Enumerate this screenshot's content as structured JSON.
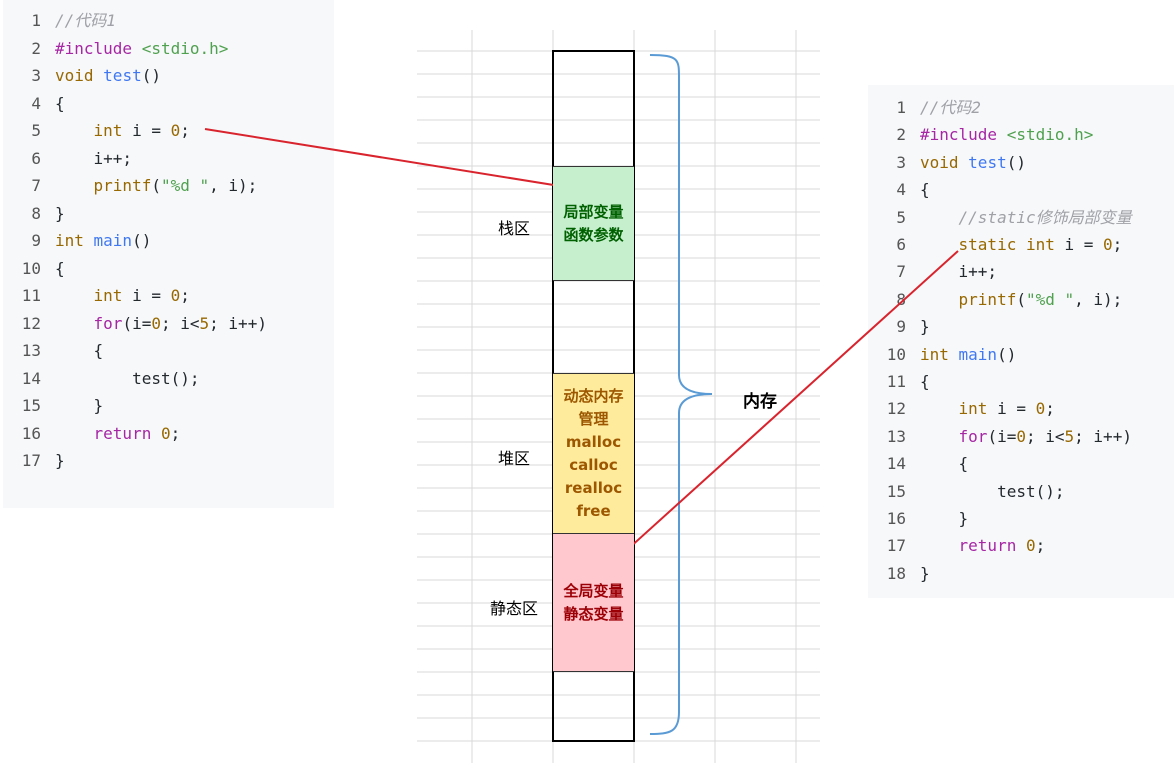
{
  "code1": {
    "lines": [
      {
        "n": "1",
        "tokens": [
          {
            "t": "//代码1",
            "c": "cm"
          }
        ]
      },
      {
        "n": "2",
        "tokens": [
          {
            "t": "#include ",
            "c": "inc"
          },
          {
            "t": "<stdio.h>",
            "c": "hdr"
          }
        ]
      },
      {
        "n": "3",
        "tokens": [
          {
            "t": "void ",
            "c": "ty"
          },
          {
            "t": "test",
            "c": "fn"
          },
          {
            "t": "()",
            "c": "pl"
          }
        ]
      },
      {
        "n": "4",
        "tokens": [
          {
            "t": "{",
            "c": "pl"
          }
        ]
      },
      {
        "n": "5",
        "tokens": [
          {
            "t": "    int ",
            "c": "ty"
          },
          {
            "t": "i = ",
            "c": "pl"
          },
          {
            "t": "0",
            "c": "num"
          },
          {
            "t": ";",
            "c": "pl"
          }
        ]
      },
      {
        "n": "6",
        "tokens": [
          {
            "t": "    i++;",
            "c": "pl"
          }
        ]
      },
      {
        "n": "7",
        "tokens": [
          {
            "t": "    printf",
            "c": "ty"
          },
          {
            "t": "(",
            "c": "pl"
          },
          {
            "t": "\"%d \"",
            "c": "str"
          },
          {
            "t": ", i);",
            "c": "pl"
          }
        ]
      },
      {
        "n": "8",
        "tokens": [
          {
            "t": "}",
            "c": "pl"
          }
        ]
      },
      {
        "n": "9",
        "tokens": [
          {
            "t": "int ",
            "c": "ty"
          },
          {
            "t": "main",
            "c": "fn"
          },
          {
            "t": "()",
            "c": "pl"
          }
        ]
      },
      {
        "n": "10",
        "tokens": [
          {
            "t": "{",
            "c": "pl"
          }
        ]
      },
      {
        "n": "11",
        "tokens": [
          {
            "t": "    int ",
            "c": "ty"
          },
          {
            "t": "i = ",
            "c": "pl"
          },
          {
            "t": "0",
            "c": "num"
          },
          {
            "t": ";",
            "c": "pl"
          }
        ]
      },
      {
        "n": "12",
        "tokens": [
          {
            "t": "    for",
            "c": "kw"
          },
          {
            "t": "(i=",
            "c": "pl"
          },
          {
            "t": "0",
            "c": "num"
          },
          {
            "t": "; i<",
            "c": "pl"
          },
          {
            "t": "5",
            "c": "num"
          },
          {
            "t": "; i++)",
            "c": "pl"
          }
        ]
      },
      {
        "n": "13",
        "tokens": [
          {
            "t": "    {",
            "c": "pl"
          }
        ]
      },
      {
        "n": "14",
        "tokens": [
          {
            "t": "        test();",
            "c": "pl"
          }
        ]
      },
      {
        "n": "15",
        "tokens": [
          {
            "t": "    }",
            "c": "pl"
          }
        ]
      },
      {
        "n": "16",
        "tokens": [
          {
            "t": "    return ",
            "c": "kw"
          },
          {
            "t": "0",
            "c": "num"
          },
          {
            "t": ";",
            "c": "pl"
          }
        ]
      },
      {
        "n": "17",
        "tokens": [
          {
            "t": "}",
            "c": "pl"
          }
        ]
      }
    ]
  },
  "code2": {
    "lines": [
      {
        "n": "1",
        "tokens": [
          {
            "t": "//代码2",
            "c": "cm"
          }
        ]
      },
      {
        "n": "2",
        "tokens": [
          {
            "t": "#include ",
            "c": "inc"
          },
          {
            "t": "<stdio.h>",
            "c": "hdr"
          }
        ]
      },
      {
        "n": "3",
        "tokens": [
          {
            "t": "void ",
            "c": "ty"
          },
          {
            "t": "test",
            "c": "fn"
          },
          {
            "t": "()",
            "c": "pl"
          }
        ]
      },
      {
        "n": "4",
        "tokens": [
          {
            "t": "{",
            "c": "pl"
          }
        ]
      },
      {
        "n": "5",
        "tokens": [
          {
            "t": "    //static修饰局部变量",
            "c": "cm"
          }
        ]
      },
      {
        "n": "6",
        "tokens": [
          {
            "t": "    static ",
            "c": "ty"
          },
          {
            "t": "int ",
            "c": "ty"
          },
          {
            "t": "i = ",
            "c": "pl"
          },
          {
            "t": "0",
            "c": "num"
          },
          {
            "t": ";",
            "c": "pl"
          }
        ]
      },
      {
        "n": "7",
        "tokens": [
          {
            "t": "    i++;",
            "c": "pl"
          }
        ]
      },
      {
        "n": "8",
        "tokens": [
          {
            "t": "    printf",
            "c": "ty"
          },
          {
            "t": "(",
            "c": "pl"
          },
          {
            "t": "\"%d \"",
            "c": "str"
          },
          {
            "t": ", i);",
            "c": "pl"
          }
        ]
      },
      {
        "n": "9",
        "tokens": [
          {
            "t": "}",
            "c": "pl"
          }
        ]
      },
      {
        "n": "10",
        "tokens": [
          {
            "t": "int ",
            "c": "ty"
          },
          {
            "t": "main",
            "c": "fn"
          },
          {
            "t": "()",
            "c": "pl"
          }
        ]
      },
      {
        "n": "11",
        "tokens": [
          {
            "t": "{",
            "c": "pl"
          }
        ]
      },
      {
        "n": "12",
        "tokens": [
          {
            "t": "    int ",
            "c": "ty"
          },
          {
            "t": "i = ",
            "c": "pl"
          },
          {
            "t": "0",
            "c": "num"
          },
          {
            "t": ";",
            "c": "pl"
          }
        ]
      },
      {
        "n": "13",
        "tokens": [
          {
            "t": "    for",
            "c": "kw"
          },
          {
            "t": "(i=",
            "c": "pl"
          },
          {
            "t": "0",
            "c": "num"
          },
          {
            "t": "; i<",
            "c": "pl"
          },
          {
            "t": "5",
            "c": "num"
          },
          {
            "t": "; i++)",
            "c": "pl"
          }
        ]
      },
      {
        "n": "14",
        "tokens": [
          {
            "t": "    {",
            "c": "pl"
          }
        ]
      },
      {
        "n": "15",
        "tokens": [
          {
            "t": "        test();",
            "c": "pl"
          }
        ]
      },
      {
        "n": "16",
        "tokens": [
          {
            "t": "    }",
            "c": "pl"
          }
        ]
      },
      {
        "n": "17",
        "tokens": [
          {
            "t": "    return ",
            "c": "kw"
          },
          {
            "t": "0",
            "c": "num"
          },
          {
            "t": ";",
            "c": "pl"
          }
        ]
      },
      {
        "n": "18",
        "tokens": [
          {
            "t": "}",
            "c": "pl"
          }
        ]
      }
    ]
  },
  "memory": {
    "stack_label": "栈区",
    "heap_label": "堆区",
    "static_label": "静态区",
    "stack_box": [
      "局部变量",
      "函数参数"
    ],
    "heap_box": [
      "动态内存",
      "管理",
      "malloc",
      "calloc",
      "realloc",
      "free"
    ],
    "static_box": [
      "全局变量",
      "静态变量"
    ],
    "memory_label": "内存"
  },
  "colors": {
    "arrow": "#d9232d",
    "brace": "#5b9bd5",
    "stack_fill": "#c6efce",
    "heap_fill": "#ffeb9c",
    "static_fill": "#ffc7ce"
  }
}
